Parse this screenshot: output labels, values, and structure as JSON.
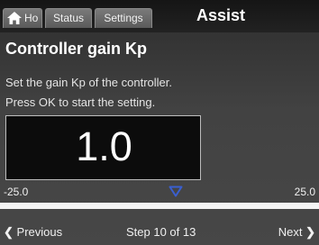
{
  "tabs": {
    "home": "Ho",
    "status": "Status",
    "settings": "Settings"
  },
  "mode_title": "Assist",
  "heading": "Controller gain Kp",
  "description": {
    "line1": "Set the gain Kp of the controller.",
    "line2": "Press OK to start the setting."
  },
  "value": "1.0",
  "scale": {
    "min": "-25.0",
    "max": "25.0",
    "marker_icon": "triangle-down-outline"
  },
  "nav": {
    "previous_label": "Previous",
    "step_text": "Step 10 of 13",
    "next_label": "Next",
    "previous_icon": "chevron-left",
    "next_icon": "chevron-right"
  },
  "colors": {
    "marker": "#3a5fd0",
    "bar": "#f5f5f5",
    "value_box_bg": "#0c0c0c"
  }
}
